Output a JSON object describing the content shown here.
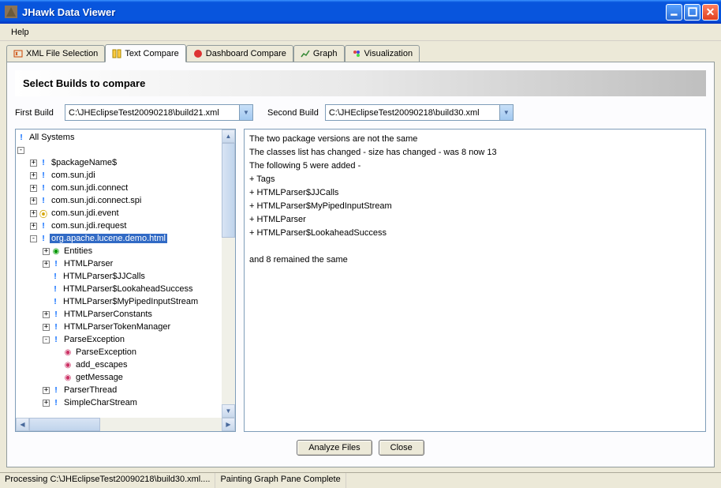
{
  "window": {
    "title": "JHawk Data Viewer"
  },
  "menubar": {
    "help": "Help"
  },
  "tabs": [
    {
      "label": "XML File Selection",
      "icon": "xml"
    },
    {
      "label": "Text Compare",
      "icon": "text",
      "active": true
    },
    {
      "label": "Dashboard Compare",
      "icon": "dash"
    },
    {
      "label": "Graph",
      "icon": "graph"
    },
    {
      "label": "Visualization",
      "icon": "viz"
    }
  ],
  "section": {
    "title": "Select Builds to compare"
  },
  "builds": {
    "first_label": "First Build",
    "first_path": "C:\\JHEclipseTest20090218\\build21.xml",
    "second_label": "Second Build",
    "second_path": "C:\\JHEclipseTest20090218\\build30.xml"
  },
  "tree": {
    "root": "All Systems",
    "nodes": [
      {
        "depth": 1,
        "exp": "+",
        "icon": "pkg",
        "label": "$packageName$"
      },
      {
        "depth": 1,
        "exp": "+",
        "icon": "pkg",
        "label": "com.sun.jdi"
      },
      {
        "depth": 1,
        "exp": "+",
        "icon": "pkg",
        "label": "com.sun.jdi.connect"
      },
      {
        "depth": 1,
        "exp": "+",
        "icon": "pkg",
        "label": "com.sun.jdi.connect.spi"
      },
      {
        "depth": 1,
        "exp": "+",
        "icon": "multi",
        "label": "com.sun.jdi.event"
      },
      {
        "depth": 1,
        "exp": "+",
        "icon": "pkg",
        "label": "com.sun.jdi.request"
      },
      {
        "depth": 1,
        "exp": "-",
        "icon": "pkg",
        "label": "org.apache.lucene.demo.html",
        "selected": true
      },
      {
        "depth": 2,
        "exp": "+",
        "icon": "class",
        "label": "Entities"
      },
      {
        "depth": 2,
        "exp": "+",
        "icon": "pkg",
        "label": "HTMLParser"
      },
      {
        "depth": 2,
        "exp": "",
        "icon": "pkg",
        "label": "HTMLParser$JJCalls"
      },
      {
        "depth": 2,
        "exp": "",
        "icon": "pkg",
        "label": "HTMLParser$LookaheadSuccess"
      },
      {
        "depth": 2,
        "exp": "",
        "icon": "pkg",
        "label": "HTMLParser$MyPipedInputStream"
      },
      {
        "depth": 2,
        "exp": "+",
        "icon": "pkg",
        "label": "HTMLParserConstants"
      },
      {
        "depth": 2,
        "exp": "+",
        "icon": "pkg",
        "label": "HTMLParserTokenManager"
      },
      {
        "depth": 2,
        "exp": "-",
        "icon": "pkg",
        "label": "ParseException"
      },
      {
        "depth": 3,
        "exp": "",
        "icon": "method",
        "label": "ParseException"
      },
      {
        "depth": 3,
        "exp": "",
        "icon": "method",
        "label": "add_escapes"
      },
      {
        "depth": 3,
        "exp": "",
        "icon": "method",
        "label": "getMessage"
      },
      {
        "depth": 2,
        "exp": "+",
        "icon": "pkg",
        "label": "ParserThread"
      },
      {
        "depth": 2,
        "exp": "+",
        "icon": "pkg",
        "label": "SimpleCharStream"
      }
    ]
  },
  "compare_text": [
    "The two package versions are not the same",
    "The classes list has changed  - size has changed - was 8 now 13",
    " The following 5 were added -",
    " + Tags",
    " + HTMLParser$JJCalls",
    " + HTMLParser$MyPipedInputStream",
    " + HTMLParser",
    " + HTMLParser$LookaheadSuccess",
    "",
    " and 8 remained the same"
  ],
  "buttons": {
    "analyze": "Analyze Files",
    "close": "Close"
  },
  "status": {
    "cell1": "Processing C:\\JHEclipseTest20090218\\build30.xml....",
    "cell2": "Painting Graph Pane Complete"
  }
}
